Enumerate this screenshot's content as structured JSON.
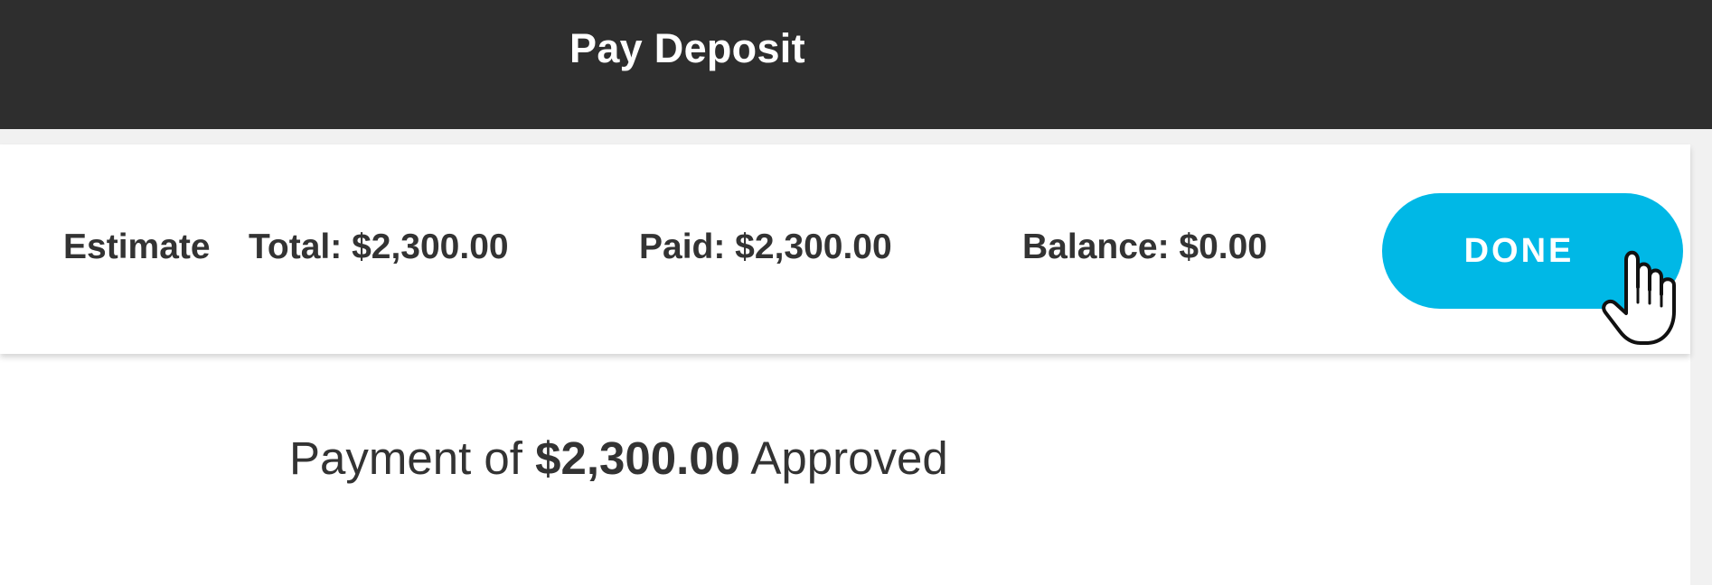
{
  "header": {
    "title": "Pay Deposit"
  },
  "summary": {
    "estimate_label": "Estimate",
    "total": "Total: $2,300.00",
    "paid": "Paid: $2,300.00",
    "balance": "Balance: $0.00",
    "done_label": "DONE"
  },
  "payment": {
    "prefix": "Payment of",
    "amount": "$2,300.00",
    "suffix": "Approved"
  },
  "colors": {
    "header_background": "#2e2e2e",
    "done_button": "#00b8e6",
    "text": "#333333"
  },
  "icons": {
    "cursor": "hand-pointer-icon"
  }
}
